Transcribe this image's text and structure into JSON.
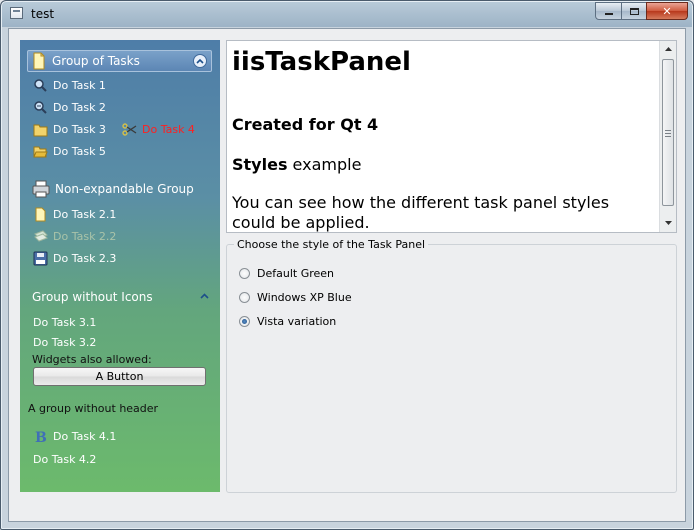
{
  "window": {
    "title": "test"
  },
  "taskpanel": {
    "group1": {
      "title": "Group of Tasks",
      "tasks": [
        "Do Task 1",
        "Do Task 2",
        "Do Task 3",
        "Do Task 4",
        "Do Task 5"
      ]
    },
    "group2": {
      "title": "Non-expandable Group",
      "tasks": [
        "Do Task 2.1",
        "Do Task 2.2",
        "Do Task 2.3"
      ]
    },
    "group3": {
      "title": "Group without Icons",
      "tasks": [
        "Do Task 3.1",
        "Do Task 3.2"
      ],
      "widgets_label": "Widgets also allowed:",
      "button_label": "A Button"
    },
    "group4": {
      "header_label": "A group without header",
      "tasks": [
        "Do Task 4.1",
        "Do Task 4.2"
      ]
    }
  },
  "textview": {
    "heading": "iisTaskPanel",
    "subheading": "Created for Qt 4",
    "styles_bold": "Styles",
    "styles_rest": " example",
    "paragraph": "You can see how the different task panel styles could be applied."
  },
  "style_group": {
    "title": "Choose the style of the Task Panel",
    "options": [
      "Default Green",
      "Windows XP Blue",
      "Vista variation"
    ],
    "selected": "Vista variation"
  },
  "colors": {
    "disabled_task": "#a9c3a9",
    "highlight_task": "#ff2020"
  }
}
